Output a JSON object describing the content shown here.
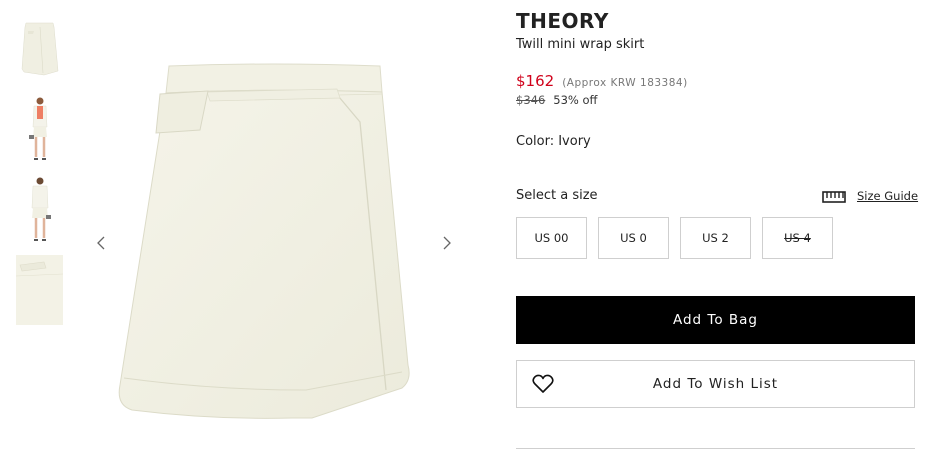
{
  "thumbnails": [
    {
      "name": "thumb-skirt-front",
      "icon": "skirt-image"
    },
    {
      "name": "thumb-model-front",
      "icon": "model-image"
    },
    {
      "name": "thumb-model-back",
      "icon": "model-image"
    },
    {
      "name": "thumb-fabric-detail",
      "icon": "fabric-detail-image"
    }
  ],
  "gallery": {
    "prev_icon": "chevron-left-icon",
    "next_icon": "chevron-right-icon"
  },
  "product": {
    "brand": "THEORY",
    "name": "Twill mini wrap skirt",
    "price": "$162",
    "approx_price": "(Approx KRW 183384)",
    "original_price": "$346",
    "discount": "53% off",
    "color_label": "Color: Ivory"
  },
  "size_selector": {
    "label": "Select a size",
    "size_guide_label": "Size Guide",
    "size_guide_icon": "ruler-icon",
    "sizes": [
      {
        "label": "US 00",
        "available": true
      },
      {
        "label": "US 0",
        "available": true
      },
      {
        "label": "US 2",
        "available": true
      },
      {
        "label": "US 4",
        "available": false
      }
    ]
  },
  "actions": {
    "add_to_bag": "Add To Bag",
    "add_to_wishlist": "Add To Wish List",
    "wishlist_icon": "heart-icon"
  },
  "colors": {
    "sale_price": "#d0021b",
    "primary_button": "#000000",
    "skirt": "#f3f2e6",
    "border": "#cfcfcf"
  }
}
